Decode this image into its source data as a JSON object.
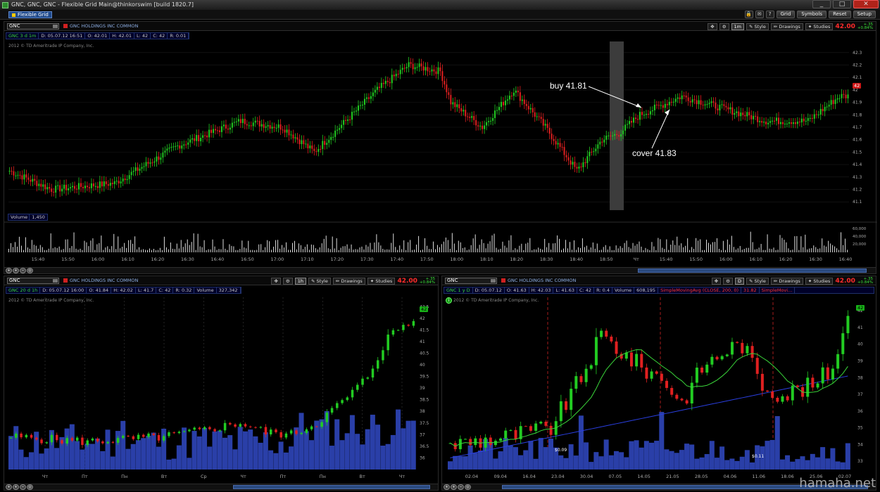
{
  "window": {
    "title": "GNC, GNC, GNC - Flexible Grid Main@thinkorswim [build 1820.7]",
    "tab_label": "Flexible Grid",
    "menu": [
      "Grid",
      "Symbols",
      "Reset",
      "Setup"
    ]
  },
  "panels": {
    "main": {
      "symbol": "GNC",
      "company": "GNC HOLDINGS INC COMMON",
      "aggregation": "1m",
      "tools": [
        "Style",
        "Drawings",
        "Studies"
      ],
      "price": "42.00",
      "change": "+.35",
      "change_pct": "+0.84%",
      "info": {
        "sym": "GNC 3 d 1m",
        "d": "D: 05.07.12 16:51",
        "o": "O: 42.01",
        "h": "H: 42.01",
        "l": "L: 42",
        "c": "C: 42",
        "r": "R: 0.01"
      },
      "copyright": "2012 © TD Ameritrade IP Company, Inc.",
      "volume_label": "Volume",
      "volume_value": "1,450",
      "last_tag": "42",
      "price_ticks": [
        "42.3",
        "42.2",
        "42.1",
        "42",
        "41.9",
        "41.8",
        "41.7",
        "41.6",
        "41.5",
        "41.4",
        "41.3",
        "41.2",
        "41.1"
      ],
      "volume_ticks": [
        "60,000",
        "40,000",
        "20,000"
      ],
      "time_ticks": [
        "15:40",
        "15:50",
        "16:00",
        "16:10",
        "16:20",
        "16:30",
        "16:40",
        "16:50",
        "17:00",
        "17:10",
        "17:20",
        "17:30",
        "17:40",
        "17:50",
        "18:00",
        "18:10",
        "18:20",
        "18:30",
        "18:40",
        "18:50",
        "Чт",
        "15:40",
        "15:50",
        "16:00",
        "16:10",
        "16:20",
        "16:30",
        "16:40"
      ],
      "annotations": {
        "buy": "buy 41.81",
        "cover": "cover 41.83"
      }
    },
    "left": {
      "symbol": "GNC",
      "company": "GNC HOLDINGS INC COMMON",
      "aggregation": "1h",
      "tools": [
        "Style",
        "Drawings",
        "Studies"
      ],
      "price": "42.00",
      "change": "+.35",
      "change_pct": "+0.84%",
      "info": {
        "sym": "GNC 20 d 1h",
        "d": "D: 05.07.12 16:00",
        "o": "O: 41.84",
        "h": "H: 42.02",
        "l": "L: 41.7",
        "c": "C: 42",
        "r": "R: 0.32",
        "vol": "Volume",
        "volv": "327,342"
      },
      "copyright": "2012 © TD Ameritrade IP Company, Inc.",
      "last_tag": "42",
      "price_ticks": [
        "42.5",
        "42",
        "41.5",
        "41",
        "40.5",
        "40",
        "39.5",
        "39",
        "38.5",
        "38",
        "37.5",
        "37",
        "36.5",
        "36"
      ],
      "time_ticks": [
        "Чт",
        "Пт",
        "Пн",
        "Вт",
        "Ср",
        "Чт",
        "Пт",
        "Пн",
        "Вт",
        "Чт"
      ]
    },
    "right": {
      "symbol": "GNC",
      "company": "GNC HOLDINGS INC COMMON",
      "aggregation": "D",
      "tools": [
        "Style",
        "Drawings",
        "Studies"
      ],
      "price": "42.00",
      "change": "+.35",
      "change_pct": "+0.84%",
      "info": {
        "sym": "GNC 1 y D",
        "d": "D: 05.07.12",
        "o": "O: 41.63",
        "h": "H: 42.03",
        "l": "L: 41.63",
        "c": "C: 42",
        "r": "R: 0.4",
        "vol": "Volume",
        "volv": "608,195",
        "sma1": "SimpleMovingAvg (CLOSE, 200, 0)",
        "sma1v": "31.82",
        "sma3": "SimpleMovi..."
      },
      "copyright": "2012 © TD Ameritrade IP Company, Inc.",
      "last_tag": "42",
      "price_ticks": [
        "42",
        "41",
        "40",
        "39",
        "38",
        "37",
        "36",
        "35",
        "34",
        "33"
      ],
      "time_ticks": [
        "02.04",
        "09.04",
        "16.04",
        "23.04",
        "30.04",
        "07.05",
        "14.05",
        "21.05",
        "28.05",
        "04.06",
        "11.06",
        "18.06",
        "25.06",
        "02.07"
      ],
      "event_labels": [
        "$0.09",
        "$0.11"
      ]
    }
  },
  "colors": {
    "up": "#22cc22",
    "down": "#e02020",
    "volume": "#2a3fa8",
    "accent": "#1f4a8c"
  },
  "watermark": "hamaha.net"
}
